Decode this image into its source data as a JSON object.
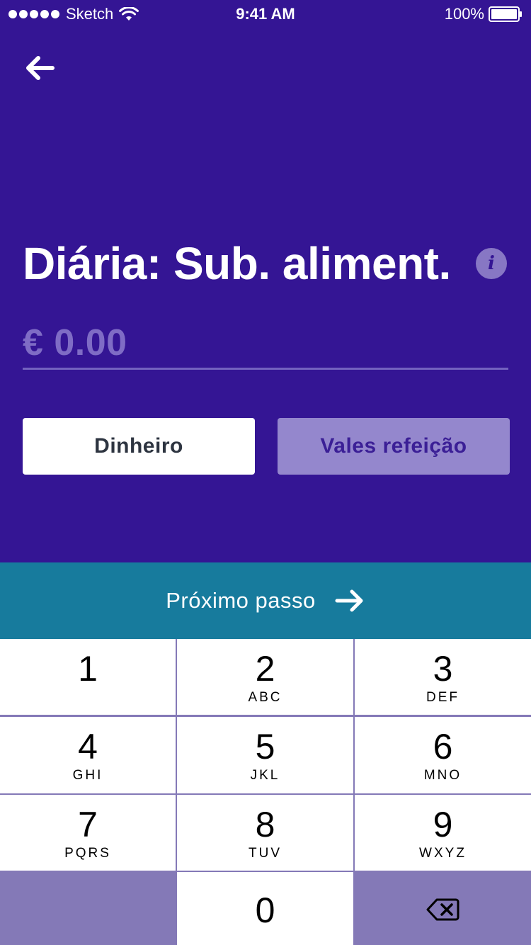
{
  "status_bar": {
    "carrier": "Sketch",
    "time": "9:41 AM",
    "battery": "100%"
  },
  "header": {
    "back_icon": "arrow-left-icon",
    "title": "Diária: Sub. aliment.",
    "info_label": "i"
  },
  "amount": {
    "value": "€ 0.00"
  },
  "payment_options": [
    {
      "label": "Dinheiro",
      "selected": true
    },
    {
      "label": "Vales refeição",
      "selected": false
    }
  ],
  "next_step": {
    "label": "Próximo passo",
    "icon": "arrow-right-icon"
  },
  "keypad": {
    "keys": [
      {
        "digit": "1",
        "letters": ""
      },
      {
        "digit": "2",
        "letters": "ABC"
      },
      {
        "digit": "3",
        "letters": "DEF"
      },
      {
        "digit": "4",
        "letters": "GHI"
      },
      {
        "digit": "5",
        "letters": "JKL"
      },
      {
        "digit": "6",
        "letters": "MNO"
      },
      {
        "digit": "7",
        "letters": "PQRS"
      },
      {
        "digit": "8",
        "letters": "TUV"
      },
      {
        "digit": "9",
        "letters": "WXYZ"
      },
      {
        "digit": "0",
        "letters": ""
      }
    ],
    "delete_icon": "backspace-icon"
  },
  "colors": {
    "background": "#341594",
    "next_step_bar": "#177b9d",
    "keypad_dark": "#8479b7",
    "amount_placeholder": "#7f6cc5"
  }
}
